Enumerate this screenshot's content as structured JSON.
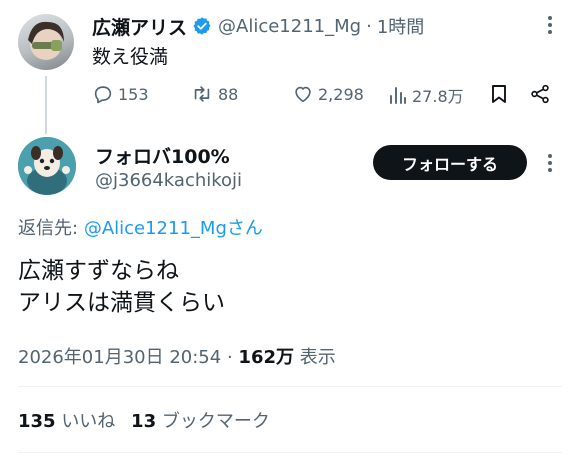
{
  "original_tweet": {
    "display_name": "広瀬アリス",
    "handle": "@Alice1211_Mg",
    "separator": "·",
    "time": "1時間",
    "text": "数え役満",
    "stats": {
      "replies": "153",
      "retweets": "88",
      "likes": "2,298",
      "views": "27.8万"
    }
  },
  "reply": {
    "display_name": "フォロバ100%",
    "handle": "@j3664kachikoji",
    "follow_label": "フォローする",
    "reply_to_prefix": "返信先:",
    "reply_to_handle": "@Alice1211_Mgさん",
    "text_line1": "広瀬すずならね",
    "text_line2": "アリスは満貫くらい",
    "date": "2026年01月30日 20:54",
    "separator": "·",
    "views_count": "162万",
    "views_label": "表示",
    "likes_count": "135",
    "likes_label": "いいね",
    "bookmarks_count": "13",
    "bookmarks_label": "ブックマーク"
  },
  "colors": {
    "accent": "#1d9bf0",
    "text": "#0f1419",
    "secondary": "#536471",
    "divider": "#eff3f4",
    "follow_button_bg": "#0f1419"
  },
  "icons": [
    "verified-badge-icon",
    "more-icon",
    "reply-icon",
    "retweet-icon",
    "like-icon",
    "views-icon",
    "bookmark-icon",
    "share-icon"
  ]
}
